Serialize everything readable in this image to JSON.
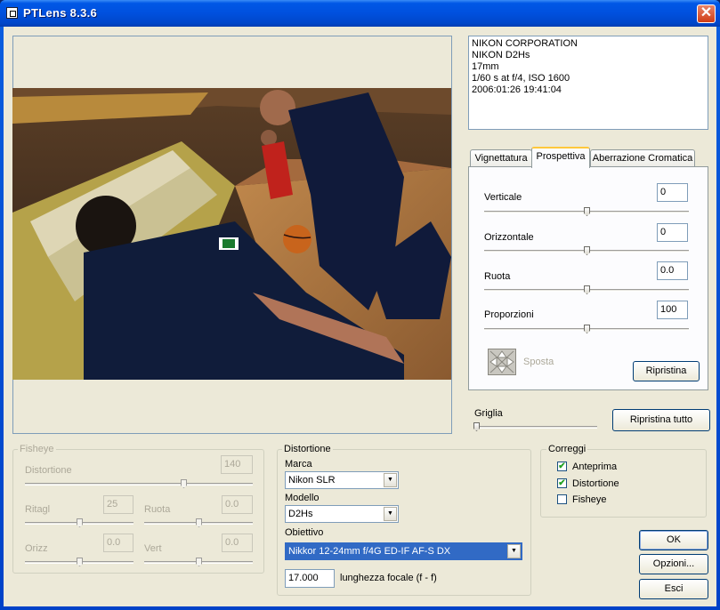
{
  "window": {
    "title": "PTLens 8.3.6"
  },
  "exif": [
    "NIKON CORPORATION",
    "NIKON D2Hs",
    "17mm",
    "1/60 s at f/4, ISO 1600",
    "2006:01:26 19:41:04"
  ],
  "tabs": [
    {
      "label": "Vignettatura"
    },
    {
      "label": "Prospettiva"
    },
    {
      "label": "Aberrazione Cromatica"
    }
  ],
  "perspective": {
    "verticale": {
      "label": "Verticale",
      "value": "0",
      "slider": 0.5
    },
    "orizzontale": {
      "label": "Orizzontale",
      "value": "0",
      "slider": 0.5
    },
    "ruota": {
      "label": "Ruota",
      "value": "0.0",
      "slider": 0.5
    },
    "proporzioni": {
      "label": "Proporzioni",
      "value": "100",
      "slider": 0.5
    },
    "move_label": "Sposta",
    "reset_label": "Ripristina"
  },
  "grid": {
    "label": "Griglia",
    "slider": 0.0,
    "reset_all_label": "Ripristina tutto"
  },
  "fisheye": {
    "title": "Fisheye",
    "distortion": {
      "label": "Distortione",
      "value": "140"
    },
    "crop": {
      "label": "Ritagl",
      "value": "25"
    },
    "rotate": {
      "label": "Ruota",
      "value": "0.0"
    },
    "horiz": {
      "label": "Orizz",
      "value": "0.0"
    },
    "vert": {
      "label": "Vert",
      "value": "0.0"
    }
  },
  "distortion": {
    "title": "Distortione",
    "brand_label": "Marca",
    "brand_value": "Nikon SLR",
    "model_label": "Modello",
    "model_value": "D2Hs",
    "lens_label": "Obiettivo",
    "lens_value": "Nikkor 12-24mm f/4G ED-IF AF-S DX",
    "focal_value": "17.000",
    "focal_label": "lunghezza focale (f - f)"
  },
  "correct": {
    "title": "Correggi",
    "items": [
      {
        "label": "Anteprima",
        "checked": true
      },
      {
        "label": "Distortione",
        "checked": true
      },
      {
        "label": "Fisheye",
        "checked": false
      }
    ]
  },
  "buttons": {
    "ok": "OK",
    "options": "Opzioni...",
    "exit": "Esci"
  },
  "colors": {
    "titlebar": "#0054e3",
    "face": "#ece9d8",
    "selection": "#316ac5",
    "close": "#d03c14"
  },
  "icons": {
    "app": "app-icon",
    "close": "close-icon",
    "move": "move-arrows-icon",
    "dropdown": "chevron-down-icon",
    "check": "check-icon"
  }
}
